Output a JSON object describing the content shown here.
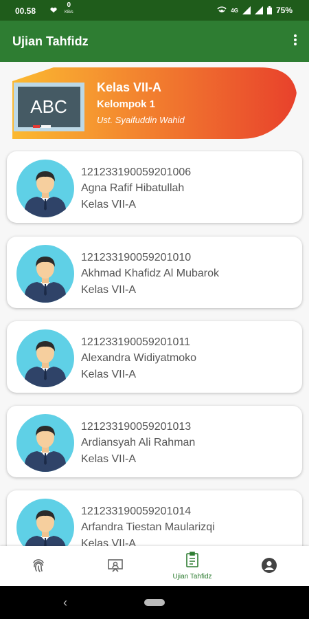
{
  "status_bar": {
    "time": "00.58",
    "speed_value": "0",
    "speed_unit": "KB/s",
    "network": "4G",
    "battery": "75%"
  },
  "app_bar": {
    "title": "Ujian Tahfidz"
  },
  "banner": {
    "class_name": "Kelas VII-A",
    "group_name": "Kelompok 1",
    "teacher": "Ust. Syaifuddin Wahid",
    "board_text": "ABC"
  },
  "students": [
    {
      "nis": "121233190059201006",
      "name": "Agna Rafif Hibatullah",
      "kelas": "Kelas VII-A"
    },
    {
      "nis": "121233190059201010",
      "name": "Akhmad Khafidz Al Mubarok",
      "kelas": "Kelas VII-A"
    },
    {
      "nis": "121233190059201011",
      "name": "Alexandra Widiyatmoko",
      "kelas": "Kelas VII-A"
    },
    {
      "nis": "121233190059201013",
      "name": "Ardiansyah Ali Rahman",
      "kelas": "Kelas VII-A"
    },
    {
      "nis": "121233190059201014",
      "name": "Arfandra Tiestan Maularizqi",
      "kelas": "Kelas VII-A"
    }
  ],
  "bottom_nav": {
    "items": [
      {
        "icon": "fingerprint-icon",
        "label": ""
      },
      {
        "icon": "presentation-icon",
        "label": ""
      },
      {
        "icon": "clipboard-icon",
        "label": "Ujian Tahfidz",
        "active": true
      },
      {
        "icon": "account-icon",
        "label": ""
      }
    ]
  },
  "colors": {
    "primary": "#2e7d32",
    "status_bar": "#1f5c1b",
    "banner_start": "#f9b233",
    "banner_end": "#e8432d",
    "active": "#2e7d32"
  }
}
